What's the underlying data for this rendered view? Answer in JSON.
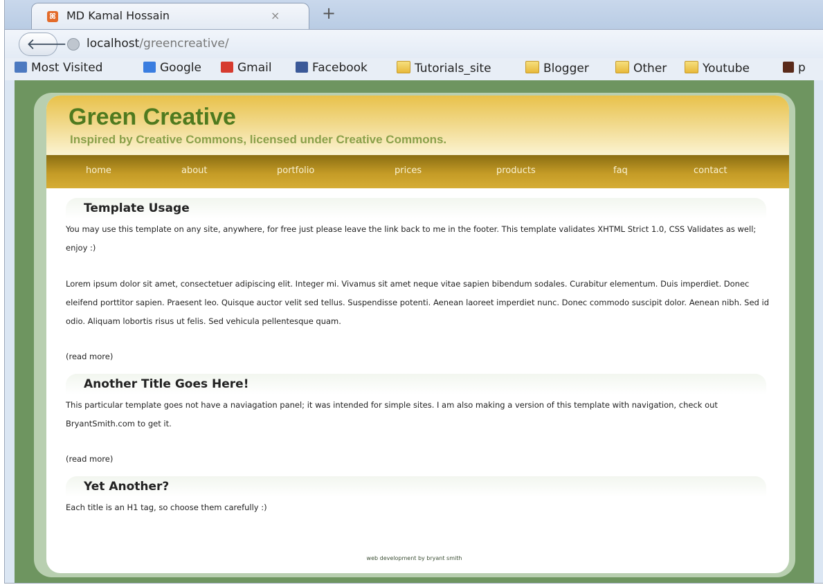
{
  "browser": {
    "tab_title": "MD Kamal Hossain",
    "tab_close": "×",
    "new_tab": "+",
    "url_host": "localhost",
    "url_path": "/greencreative/",
    "bookmarks": [
      {
        "label": "Most Visited",
        "icon": "most-visited-icon"
      },
      {
        "label": "Google",
        "icon": "google-icon"
      },
      {
        "label": "Gmail",
        "icon": "gmail-icon"
      },
      {
        "label": "Facebook",
        "icon": "facebook-icon"
      },
      {
        "label": "Tutorials_site",
        "icon": "folder-icon"
      },
      {
        "label": "Blogger",
        "icon": "folder-icon"
      },
      {
        "label": "Other",
        "icon": "folder-icon"
      },
      {
        "label": "Youtube",
        "icon": "youtube-icon"
      },
      {
        "label": "p",
        "icon": ""
      }
    ]
  },
  "site": {
    "title": "Green Creative",
    "tagline": "Inspired by Creative Commons, licensed under Creative Commons.",
    "menu": [
      "home",
      "about",
      "portfolio",
      "prices",
      "products",
      "faq",
      "contact"
    ],
    "posts": [
      {
        "title": "Template Usage",
        "paragraphs": [
          "You may use this template on any site, anywhere, for free just please leave the link back to me in the footer. This template validates XHTML Strict 1.0, CSS Validates as well; enjoy :)",
          "Lorem ipsum dolor sit amet, consectetuer adipiscing elit. Integer mi. Vivamus sit amet neque vitae sapien bibendum sodales. Curabitur elementum. Duis imperdiet. Donec eleifend porttitor sapien. Praesent leo. Quisque auctor velit sed tellus. Suspendisse potenti. Aenean laoreet imperdiet nunc. Donec commodo suscipit dolor. Aenean nibh. Sed id odio. Aliquam lobortis risus ut felis. Sed vehicula pellentesque quam."
        ],
        "read_more": "(read more)"
      },
      {
        "title": "Another Title Goes Here!",
        "paragraphs": [
          "This particular template goes not have a naviagation panel; it was intended for simple sites. I am also making a version of this template with navigation, check out BryantSmith.com to get it."
        ],
        "read_more": "(read more)"
      },
      {
        "title": "Yet Another?",
        "paragraphs": [
          "Each title is an H1 tag, so choose them carefully :)"
        ],
        "read_more": ""
      }
    ],
    "footer": "web development by bryant smith"
  },
  "colors": {
    "page_bg": "#6e9560",
    "header_gold": "#e8c14a",
    "menu_gold": "#c49b26",
    "title_green": "#4f7a1f"
  }
}
